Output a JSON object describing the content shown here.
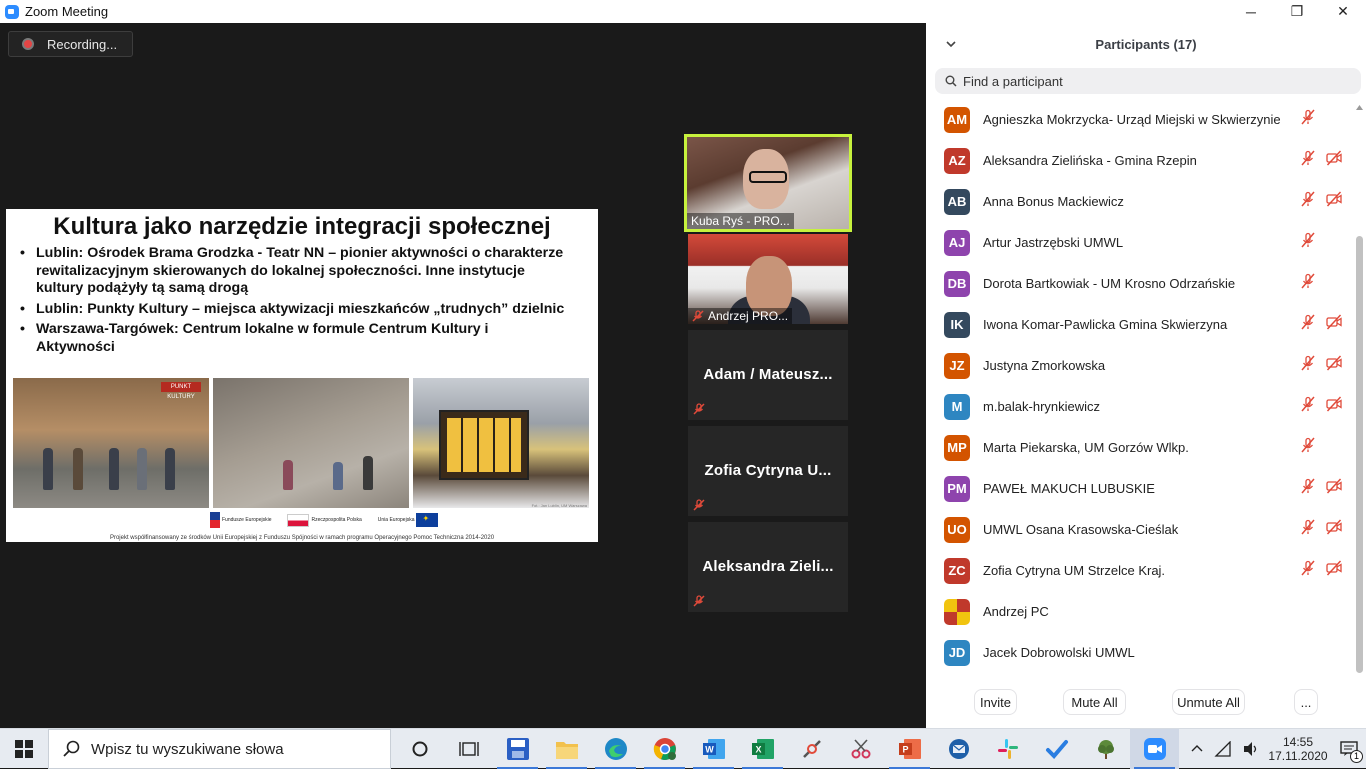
{
  "window": {
    "title": "Zoom Meeting",
    "controls": {
      "minimize": "─",
      "restore": "❐",
      "close": "✕"
    }
  },
  "recording": {
    "label": "Recording..."
  },
  "slide": {
    "title": "Kultura jako narzędzie integracji społecznej",
    "bullets": [
      "Lublin: Ośrodek Brama Grodzka - Teatr NN – pionier aktywności o charakterze rewitalizacyjnym skierowanych do lokalnej społeczności. Inne instytucje kultury podążyły tą samą drogą",
      "Lublin: Punkty Kultury – miejsca aktywizacji mieszkańców „trudnych” dzielnic",
      "Warszawa-Targówek: Centrum lokalne w formule Centrum Kultury i Aktywności"
    ],
    "photo_sign": "PUNKT KULTURY",
    "photo_credit": "Fot.: Jan Lublin, UM Warszawa",
    "logos": [
      "Fundusze Europejskie",
      "Rzeczpospolita Polska",
      "Unia Europejska"
    ],
    "footer": "Projekt współfinansowany ze środków Unii Europejskiej z Funduszu Spójności w ramach programu Operacyjnego Pomoc Techniczna 2014-2020"
  },
  "video_tiles": [
    {
      "name": "Kuba Ryś - PRO...",
      "active_speaker": true,
      "muted": false
    },
    {
      "name": "Andrzej PRO...",
      "active_speaker": false,
      "muted": true
    },
    {
      "name": "Adam / Mateusz...",
      "muted": true
    },
    {
      "name": "Zofia Cytryna U...",
      "muted": true
    },
    {
      "name": "Aleksandra Zieli...",
      "muted": true
    }
  ],
  "participants_panel": {
    "title": "Participants (17)",
    "search_placeholder": "Find a participant",
    "participants": [
      {
        "initials": "AM",
        "name": "Agnieszka Mokrzycka- Urząd Miejski w Skwierzynie",
        "color": "#d35400",
        "mic_muted": true,
        "video_off": false
      },
      {
        "initials": "AZ",
        "name": "Aleksandra Zielińska - Gmina Rzepin",
        "color": "#c0392b",
        "mic_muted": true,
        "video_off": true
      },
      {
        "initials": "AB",
        "name": "Anna Bonus Mackiewicz",
        "color": "#34495e",
        "mic_muted": true,
        "video_off": true
      },
      {
        "initials": "AJ",
        "name": "Artur Jastrzębski UMWL",
        "color": "#8e44ad",
        "mic_muted": true,
        "video_off": false
      },
      {
        "initials": "DB",
        "name": "Dorota Bartkowiak - UM Krosno Odrzańskie",
        "color": "#8e44ad",
        "mic_muted": true,
        "video_off": false
      },
      {
        "initials": "IK",
        "name": "Iwona Komar-Pawlicka Gmina Skwierzyna",
        "color": "#34495e",
        "mic_muted": true,
        "video_off": true
      },
      {
        "initials": "JZ",
        "name": "Justyna Zmorkowska",
        "color": "#d35400",
        "mic_muted": true,
        "video_off": true
      },
      {
        "initials": "M",
        "name": "m.balak-hrynkiewicz",
        "color": "#2e86c1",
        "mic_muted": true,
        "video_off": true
      },
      {
        "initials": "MP",
        "name": "Marta Piekarska, UM Gorzów Wlkp.",
        "color": "#d35400",
        "mic_muted": true,
        "video_off": false
      },
      {
        "initials": "PM",
        "name": "PAWEŁ MAKUCH LUBUSKIE",
        "color": "#8e44ad",
        "mic_muted": true,
        "video_off": true
      },
      {
        "initials": "UO",
        "name": "UMWL Osana Krasowska-Cieślak",
        "color": "#d35400",
        "mic_muted": true,
        "video_off": true
      },
      {
        "initials": "ZC",
        "name": "Zofia Cytryna UM Strzelce Kraj.",
        "color": "#c0392b",
        "mic_muted": true,
        "video_off": true
      },
      {
        "initials": "",
        "name": "Andrzej PC",
        "color": "#d4a017",
        "mic_muted": false,
        "video_off": false,
        "avatar_image": true
      },
      {
        "initials": "JD",
        "name": "Jacek Dobrowolski UMWL",
        "color": "#2e86c1",
        "mic_muted": false,
        "video_off": false
      }
    ],
    "actions": {
      "invite": "Invite",
      "mute_all": "Mute All",
      "unmute_all": "Unmute All",
      "more": "..."
    }
  },
  "taskbar": {
    "search_placeholder": "Wpisz tu wyszukiwane słowa",
    "apps": [
      "cortana-icon",
      "task-view-icon",
      "save-app-icon",
      "file-explorer-icon",
      "edge-icon",
      "chrome-icon",
      "word-icon",
      "excel-icon",
      "app-icon",
      "snip-icon",
      "powerpoint-icon",
      "thunderbird-icon",
      "slack-icon",
      "todo-icon",
      "tree-app-icon",
      "zoom-icon"
    ],
    "time": "14:55",
    "date": "17.11.2020",
    "notifications": "1"
  }
}
